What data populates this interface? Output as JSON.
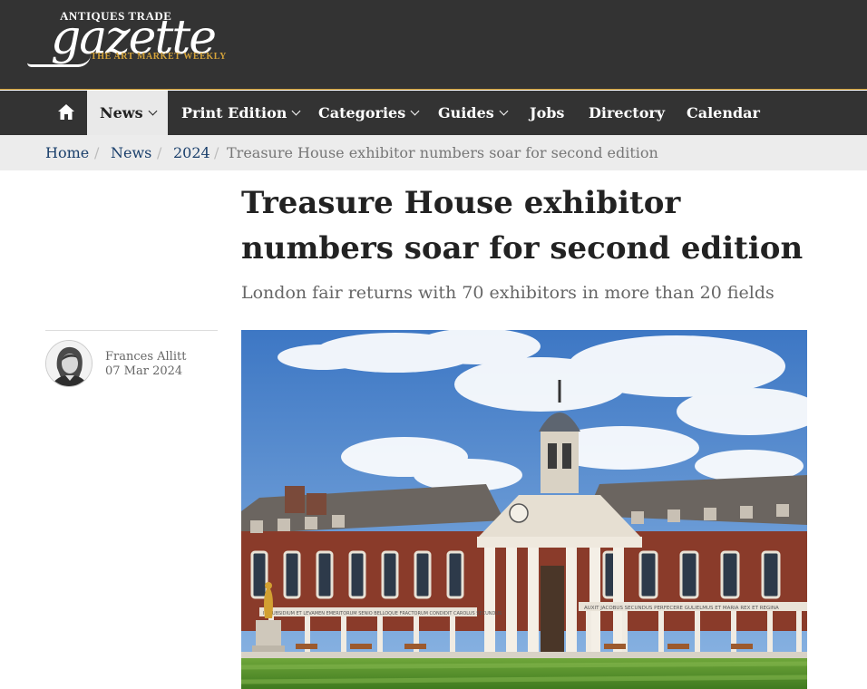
{
  "logo": {
    "top_line": "ANTIQUES TRADE",
    "wordmark": "gazette",
    "tagline": "THE ART MARKET WEEKLY"
  },
  "nav": {
    "home_icon": "home-icon",
    "items": [
      {
        "label": "News",
        "has_dropdown": true,
        "active": true
      },
      {
        "label": "Print Edition",
        "has_dropdown": true
      },
      {
        "label": "Categories",
        "has_dropdown": true
      },
      {
        "label": "Guides",
        "has_dropdown": true
      },
      {
        "label": "Jobs",
        "has_dropdown": false
      },
      {
        "label": "Directory",
        "has_dropdown": false
      },
      {
        "label": "Calendar",
        "has_dropdown": false
      }
    ]
  },
  "breadcrumb": {
    "items": [
      "Home",
      "News",
      "2024"
    ],
    "separator": "/",
    "current": "Treasure House exhibitor numbers soar for second edition"
  },
  "article": {
    "title_line1": "Treasure House exhibitor",
    "title_line2": "numbers soar for second edition",
    "standfirst": "London fair returns with 70 exhibitors in more than 20 fields",
    "author": "Frances Allitt",
    "date": "07 Mar 2024",
    "hero": {
      "frieze_left": "IN SUBSIDIUM ET LEVAMEN EMERITORUM SENIO BELLOQUE FRACTORUM CONDIDIT CAROLUS SECUNDUS",
      "frieze_right": "AUXIT JACOBUS SECUNDUS PERFECERE GULIELMUS ET MARIA REX ET REGINA"
    }
  },
  "colors": {
    "header_bg": "#333333",
    "accent_gold": "#c8962a",
    "link_blue": "#1a3f6b",
    "breadcrumb_bg": "#ececec"
  }
}
